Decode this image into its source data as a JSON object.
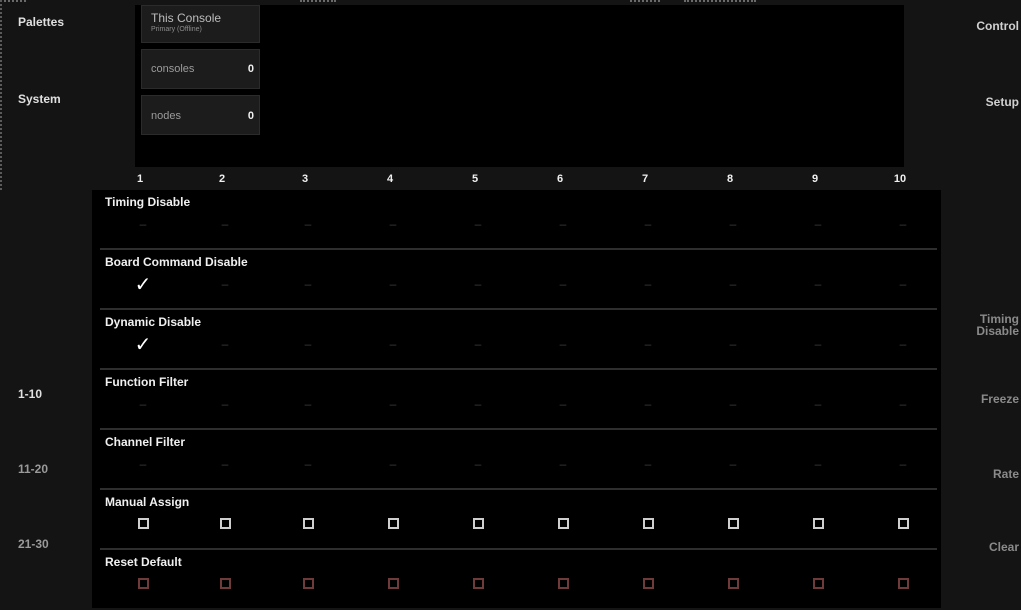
{
  "left_nav": {
    "palettes": "Palettes",
    "system": "System",
    "range_1": "1-10",
    "range_2": "11-20",
    "range_3": "21-30"
  },
  "right_nav": {
    "control": "Control",
    "setup": "Setup",
    "timing_disable_l1": "Timing",
    "timing_disable_l2": "Disable",
    "freeze": "Freeze",
    "rate": "Rate",
    "clear": "Clear"
  },
  "panel": {
    "this_console": {
      "title": "This Console",
      "subtitle": "Primary (Offline)"
    },
    "consoles": {
      "label": "consoles",
      "value": "0"
    },
    "nodes": {
      "label": "nodes",
      "value": "0"
    }
  },
  "columns": [
    "1",
    "2",
    "3",
    "4",
    "5",
    "6",
    "7",
    "8",
    "9",
    "10"
  ],
  "rows": [
    {
      "title": "Timing Disable",
      "cells": [
        "dash",
        "dash",
        "dash",
        "dash",
        "dash",
        "dash",
        "dash",
        "dash",
        "dash",
        "dash"
      ]
    },
    {
      "title": "Board Command Disable",
      "cells": [
        "check",
        "dash",
        "dash",
        "dash",
        "dash",
        "dash",
        "dash",
        "dash",
        "dash",
        "dash"
      ]
    },
    {
      "title": "Dynamic Disable",
      "cells": [
        "check",
        "dash",
        "dash",
        "dash",
        "dash",
        "dash",
        "dash",
        "dash",
        "dash",
        "dash"
      ]
    },
    {
      "title": "Function Filter",
      "cells": [
        "dash",
        "dash",
        "dash",
        "dash",
        "dash",
        "dash",
        "dash",
        "dash",
        "dash",
        "dash"
      ]
    },
    {
      "title": "Channel Filter",
      "cells": [
        "dash",
        "dash",
        "dash",
        "dash",
        "dash",
        "dash",
        "dash",
        "dash",
        "dash",
        "dash"
      ]
    },
    {
      "title": "Manual Assign",
      "cells": [
        "box",
        "box",
        "box",
        "box",
        "box",
        "box",
        "box",
        "box",
        "box",
        "box"
      ]
    },
    {
      "title": "Reset Default",
      "cells": [
        "box-red",
        "box-red",
        "box-red",
        "box-red",
        "box-red",
        "box-red",
        "box-red",
        "box-red",
        "box-red",
        "box-red"
      ]
    }
  ],
  "glyphs": {
    "dash": "–",
    "check": "✓"
  },
  "colors": {
    "background": "#141414",
    "panel": "#000000",
    "reset_box": "#6e3a3a",
    "assign_box": "#cfcfcf"
  }
}
